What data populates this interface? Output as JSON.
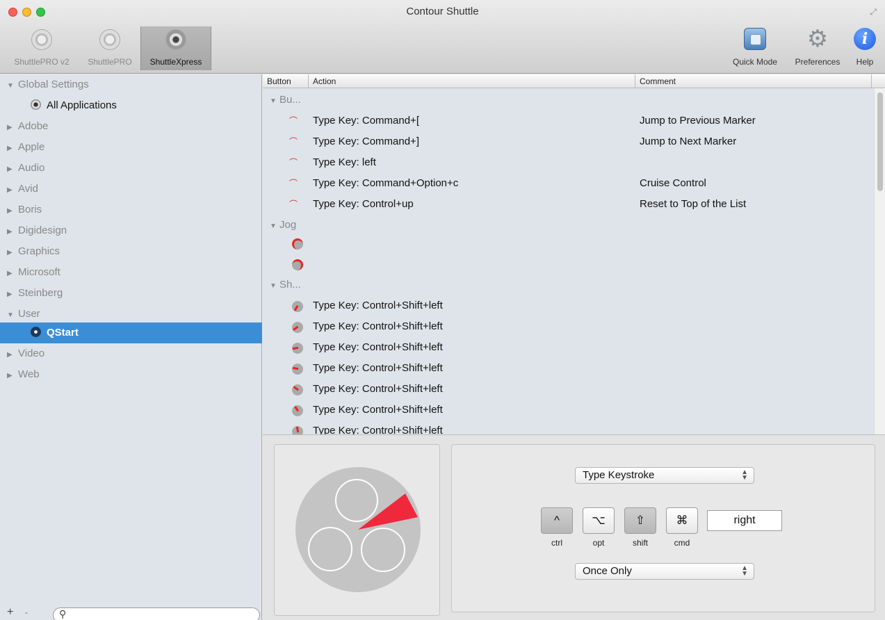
{
  "window": {
    "title": "Contour Shuttle"
  },
  "devices": [
    {
      "label": "ShuttlePRO v2"
    },
    {
      "label": "ShuttlePRO"
    },
    {
      "label": "ShuttleXpress",
      "selected": true
    }
  ],
  "toolbar": {
    "quick_mode": "Quick Mode",
    "preferences": "Preferences",
    "help": "Help",
    "help_glyph": "i"
  },
  "sidebar": {
    "items": [
      {
        "label": "Global Settings",
        "expanded": true
      },
      {
        "label": "All Applications",
        "sub": true
      },
      {
        "label": "Adobe"
      },
      {
        "label": "Apple"
      },
      {
        "label": "Audio"
      },
      {
        "label": "Avid"
      },
      {
        "label": "Boris"
      },
      {
        "label": "Digidesign"
      },
      {
        "label": "Graphics"
      },
      {
        "label": "Microsoft"
      },
      {
        "label": "Steinberg"
      },
      {
        "label": "User",
        "expanded": true
      },
      {
        "label": "QStart",
        "sub": true,
        "selected": true
      },
      {
        "label": "Video"
      },
      {
        "label": "Web"
      }
    ],
    "footer": {
      "add": "+",
      "remove": "-"
    },
    "accent_color": "#3b8ed6"
  },
  "table": {
    "columns": [
      "Button",
      "Action",
      "Comment"
    ],
    "groups": [
      {
        "label": "Bu...",
        "rows": [
          {
            "action": "Type Key: Command+[",
            "comment": "Jump to Previous Marker"
          },
          {
            "action": "Type Key: Command+]",
            "comment": "Jump to Next Marker"
          },
          {
            "action": "Type Key: left",
            "comment": ""
          },
          {
            "action": "Type Key: Command+Option+c",
            "comment": "Cruise Control"
          },
          {
            "action": "Type Key: Control+up",
            "comment": "Reset to Top of the List"
          }
        ]
      },
      {
        "label": "Jog",
        "rows": [
          {
            "action": "",
            "comment": ""
          },
          {
            "action": "",
            "comment": ""
          }
        ]
      },
      {
        "label": "Sh...",
        "rows": [
          {
            "action": "Type Key: Control+Shift+left",
            "comment": ""
          },
          {
            "action": "Type Key: Control+Shift+left",
            "comment": ""
          },
          {
            "action": "Type Key: Control+Shift+left",
            "comment": ""
          },
          {
            "action": "Type Key: Control+Shift+left",
            "comment": ""
          },
          {
            "action": "Type Key: Control+Shift+left",
            "comment": ""
          },
          {
            "action": "Type Key: Control+Shift+left",
            "comment": ""
          },
          {
            "action": "Type Key: Control+Shift+left",
            "comment": ""
          }
        ]
      }
    ]
  },
  "editor": {
    "action_type": "Type Keystroke",
    "modifiers": [
      {
        "glyph": "^",
        "label": "ctrl",
        "active": true
      },
      {
        "glyph": "⌥",
        "label": "opt",
        "active": false
      },
      {
        "glyph": "⇧",
        "label": "shift",
        "active": true
      },
      {
        "glyph": "⌘",
        "label": "cmd",
        "active": false
      }
    ],
    "key": "right",
    "repeat_mode": "Once Only",
    "highlight_color": "#f0283c"
  }
}
